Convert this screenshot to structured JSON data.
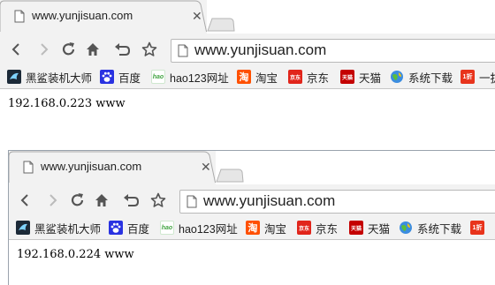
{
  "windows": [
    {
      "tab": {
        "title": "www.yunjisuan.com"
      },
      "address_bar": {
        "url": "www.yunjisuan.com"
      },
      "bookmarks": [
        {
          "label": "黑鲨装机大师",
          "icon": "shark-icon"
        },
        {
          "label": "百度",
          "icon": "baidu-paw-icon"
        },
        {
          "label": "hao123网址",
          "icon": "hao123-icon"
        },
        {
          "label": "淘宝",
          "icon": "taobao-icon"
        },
        {
          "label": "京东",
          "icon": "jd-icon"
        },
        {
          "label": "天猫",
          "icon": "tmall-icon"
        },
        {
          "label": "系统下载",
          "icon": "globe-icon"
        },
        {
          "label": "一拔",
          "icon": "onefold-icon"
        }
      ],
      "page": {
        "text": "192.168.0.223 www"
      }
    },
    {
      "tab": {
        "title": "www.yunjisuan.com"
      },
      "address_bar": {
        "url": "www.yunjisuan.com"
      },
      "bookmarks": [
        {
          "label": "黑鲨装机大师",
          "icon": "shark-icon"
        },
        {
          "label": "百度",
          "icon": "baidu-paw-icon"
        },
        {
          "label": "hao123网址",
          "icon": "hao123-icon"
        },
        {
          "label": "淘宝",
          "icon": "taobao-icon"
        },
        {
          "label": "京东",
          "icon": "jd-icon"
        },
        {
          "label": "天猫",
          "icon": "tmall-icon"
        },
        {
          "label": "系统下载",
          "icon": "globe-icon"
        }
      ],
      "page": {
        "text": "192.168.0.224 www"
      }
    }
  ],
  "icon_glyphs": {
    "taobao": "淘",
    "jd": "京东",
    "tmall": "天猫",
    "hao": "hao",
    "onefold": "1折"
  },
  "colors": {
    "chrome_bg": "#f2f2f2",
    "taobao": "#ff5000",
    "jd": "#e1251b",
    "tmall": "#c40000",
    "baidu": "#2932e1",
    "hao123": "#3fa33f"
  }
}
